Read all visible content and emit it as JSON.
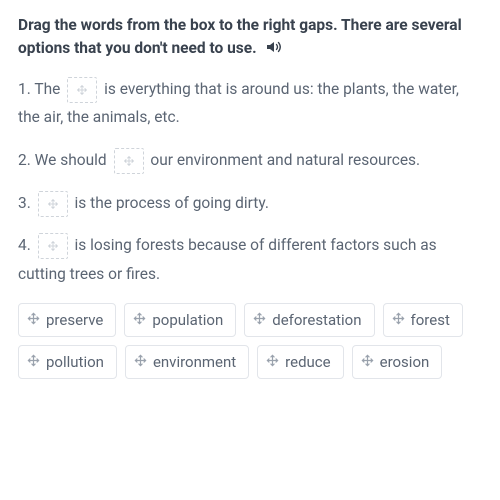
{
  "instructions": "Drag the words from the box to the right gaps. There are several options that you don't need to use.",
  "sentences": [
    {
      "num": "1.",
      "before": "The",
      "after": "is everything that is around us: the plants, the water, the air, the animals, etc."
    },
    {
      "num": "2.",
      "before": "We should",
      "after": "our environment and natural resources."
    },
    {
      "num": "3.",
      "before": "",
      "after": "is the process of going dirty."
    },
    {
      "num": "4.",
      "before": "",
      "after": "is losing forests because of different factors such as cutting trees or fires."
    }
  ],
  "words": [
    "preserve",
    "population",
    "deforestation",
    "forest",
    "pollution",
    "environment",
    "reduce",
    "erosion"
  ]
}
